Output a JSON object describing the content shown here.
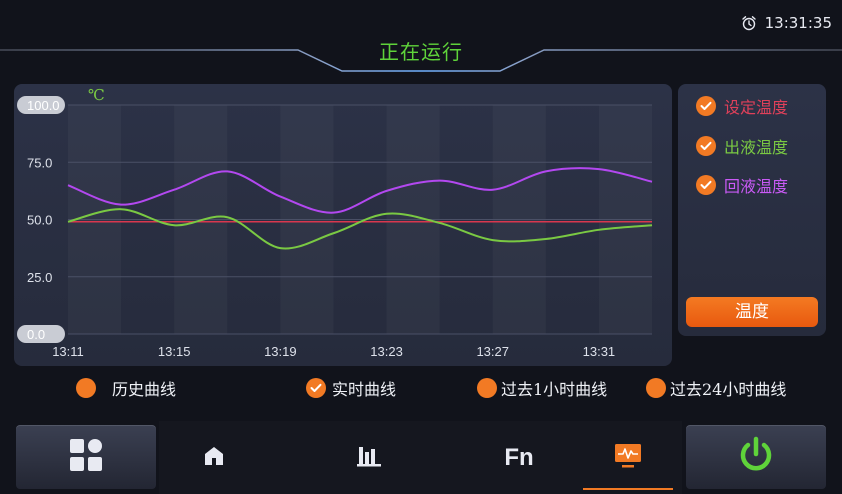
{
  "header": {
    "status": "正在运行",
    "time": "13:31:35"
  },
  "chart": {
    "unit": "℃"
  },
  "chart_data": {
    "type": "line",
    "x": [
      "13:11",
      "13:13",
      "13:15",
      "13:17",
      "13:19",
      "13:21",
      "13:23",
      "13:25",
      "13:27",
      "13:29",
      "13:31",
      "13:32"
    ],
    "xticks": [
      "13:11",
      "13:15",
      "13:19",
      "13:23",
      "13:27",
      "13:31"
    ],
    "yticks": [
      "100.0",
      "75.0",
      "50.0",
      "25.0",
      "0.0"
    ],
    "ylim": [
      0,
      100
    ],
    "series": [
      {
        "name": "设定温度",
        "color": "#d9374e",
        "values": [
          49,
          49,
          49,
          49,
          49,
          49,
          49,
          49,
          49,
          49,
          49,
          49
        ]
      },
      {
        "name": "出液温度",
        "color": "#7ac943",
        "values": [
          49,
          54.5,
          47.5,
          51,
          37.5,
          44,
          52.5,
          48.5,
          41,
          41.5,
          45.5,
          47.5
        ]
      },
      {
        "name": "回液温度",
        "color": "#b348f0",
        "values": [
          65,
          56.5,
          63,
          71,
          60,
          53,
          62.5,
          67,
          63,
          71,
          72,
          66.5
        ]
      }
    ],
    "grid": true
  },
  "legend": {
    "items": [
      {
        "label": "设定温度",
        "color": "#e0405a"
      },
      {
        "label": "出液温度",
        "color": "#7ac943"
      },
      {
        "label": "回液温度",
        "color": "#c95af5"
      }
    ],
    "button": "温度"
  },
  "modes": [
    {
      "label": "历史曲线",
      "checked": false
    },
    {
      "label": "实时曲线",
      "checked": true
    },
    {
      "label": "过去1小时曲线",
      "checked": false
    },
    {
      "label": "过去24小时曲线",
      "checked": false
    }
  ],
  "tabs": {
    "fn_label": "Fn"
  },
  "colors": {
    "accent": "#f27a24",
    "power": "#5fd33a",
    "status": "#5fd33a"
  },
  "icons": [
    "alarm-clock-icon",
    "grid-menu-icon",
    "home-icon",
    "bar-chart-icon",
    "monitor-chart-icon",
    "power-icon"
  ]
}
